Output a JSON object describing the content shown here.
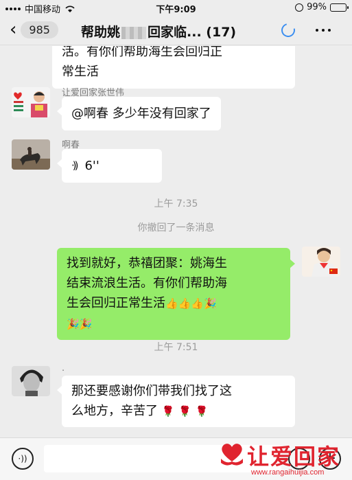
{
  "status_bar": {
    "carrier": "中国移动",
    "time": "下午9:09",
    "battery": "99%",
    "battery_level": 0.99
  },
  "nav": {
    "back_count": "985",
    "title_prefix": "帮助姚",
    "title_suffix": "回家临...",
    "member_count": "(17)"
  },
  "messages": {
    "m1": {
      "text_line1": "活。有你们帮助海生会回归正",
      "text_line2": "常生活"
    },
    "m2": {
      "sender": "让爱回家张世伟",
      "text": "@啊春 多少年没有回家了"
    },
    "m3": {
      "sender": "啊春",
      "duration": "6''"
    },
    "time1": "上午 7:35",
    "recall": "你撤回了一条消息",
    "m4": {
      "line1": "找到就好，恭禧团聚：姚海生",
      "line2": "结束流浪生活。有你们帮助海",
      "line3": "生会回归正常生活"
    },
    "time2": "上午 7:51",
    "m5": {
      "sender": ".",
      "line1": "那还要感谢你们带我们找了这",
      "line2": "么地方，辛苦了"
    }
  },
  "watermark": {
    "text": "让爱回家",
    "url": "www.rangaihuijia.com"
  },
  "colors": {
    "accent_blue": "#3b8ef0",
    "bubble_green": "#95ec69",
    "watermark_red": "#e0242f"
  }
}
